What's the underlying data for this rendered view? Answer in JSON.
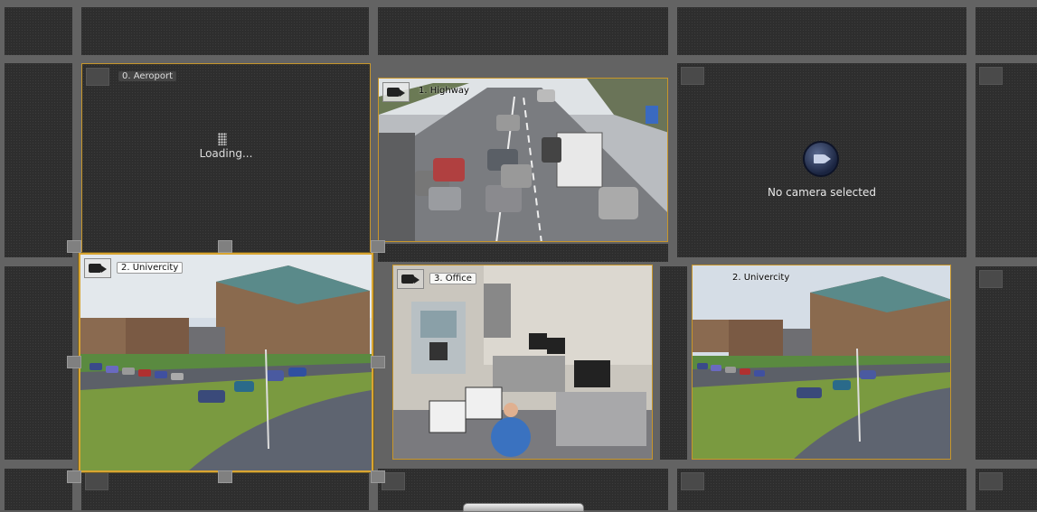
{
  "views": [
    {
      "id": "v0",
      "label": "0. Aeroport",
      "status": "Loading..."
    },
    {
      "id": "v1",
      "label": "1. Highway"
    },
    {
      "id": "v2",
      "label": "No camera selected"
    },
    {
      "id": "v3",
      "label": "2. Univercity"
    },
    {
      "id": "v4",
      "label": "3. Office"
    },
    {
      "id": "v5",
      "label": "2. Univercity"
    }
  ],
  "colors": {
    "frame": "#d9a531",
    "background": "#2e2e2e",
    "gap": "#636363"
  },
  "icons": [
    "camera-icon",
    "loading-spinner-icon",
    "no-camera-icon"
  ]
}
